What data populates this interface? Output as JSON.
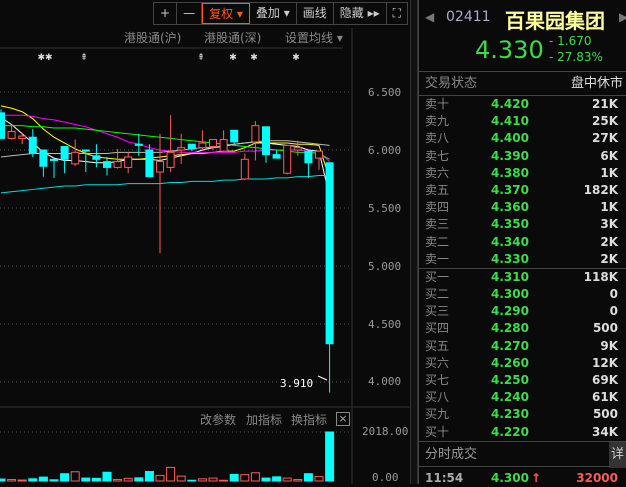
{
  "toolbar": {
    "plus": "+",
    "minus": "—",
    "fuquan": "复权 ▾",
    "overlay": "叠加 ▾",
    "draw": "画线",
    "hide": "隐藏 ▸▸",
    "fullscreen": "⛶"
  },
  "chart_tabs": {
    "hk_sh": "港股通(沪)",
    "hk_sz": "港股通(深)",
    "ma_setting": "设置均线 ▾"
  },
  "price_axis": [
    "6.500",
    "6.000",
    "5.500",
    "5.000",
    "4.500",
    "4.000"
  ],
  "low_marker": "3.910",
  "volume_tools": {
    "edit": "改参数",
    "add": "加指标",
    "switch": "换指标",
    "close": "×"
  },
  "volume_axis": [
    "2018.00",
    "0.00"
  ],
  "colors": {
    "up": "#ff5a5a",
    "down": "#00ffff",
    "green": "#3ddc4a",
    "accent": "#ff5a14"
  },
  "chart_data": {
    "type": "candlestick",
    "ylim": [
      3.85,
      6.6
    ],
    "ohlc": [
      [
        6.32,
        6.35,
        6.1,
        6.1
      ],
      [
        6.1,
        6.22,
        6.09,
        6.16
      ],
      [
        6.1,
        6.15,
        6.05,
        6.12
      ],
      [
        6.11,
        6.18,
        5.94,
        5.97
      ],
      [
        6.0,
        6.0,
        5.77,
        5.86
      ],
      [
        5.92,
        5.92,
        5.76,
        5.91
      ],
      [
        6.03,
        6.03,
        5.8,
        5.92
      ],
      [
        5.88,
        6.09,
        5.86,
        5.98
      ],
      [
        6.0,
        6.0,
        5.81,
        5.99
      ],
      [
        5.95,
        6.05,
        5.85,
        5.92
      ],
      [
        5.9,
        5.94,
        5.78,
        5.85
      ],
      [
        5.85,
        6.01,
        5.84,
        5.9
      ],
      [
        5.85,
        5.98,
        5.8,
        5.94
      ],
      [
        6.05,
        6.14,
        5.95,
        6.04
      ],
      [
        6.0,
        6.05,
        5.77,
        5.77
      ],
      [
        5.81,
        6.14,
        5.11,
        5.9
      ],
      [
        5.85,
        6.3,
        5.81,
        5.98
      ],
      [
        6.0,
        6.14,
        5.88,
        6.02
      ],
      [
        6.05,
        6.05,
        5.99,
        6.01
      ],
      [
        6.02,
        6.17,
        6.0,
        6.06
      ],
      [
        6.03,
        6.09,
        6.0,
        6.09
      ],
      [
        5.99,
        6.17,
        5.98,
        6.09
      ],
      [
        6.17,
        6.17,
        6.05,
        6.07
      ],
      [
        5.75,
        5.97,
        5.74,
        5.92
      ],
      [
        6.07,
        6.25,
        5.91,
        6.21
      ],
      [
        6.2,
        6.2,
        5.89,
        5.96
      ],
      [
        5.96,
        6.0,
        5.93,
        5.93
      ],
      [
        5.8,
        6.04,
        5.79,
        6.04
      ],
      [
        6.0,
        6.08,
        5.95,
        6.02
      ],
      [
        5.99,
        5.99,
        5.76,
        5.89
      ],
      [
        5.93,
        5.99,
        5.83,
        5.99
      ],
      [
        5.89,
        5.89,
        3.91,
        4.33
      ]
    ],
    "volume": [
      80,
      60,
      40,
      90,
      160,
      50,
      300,
      380,
      120,
      110,
      360,
      60,
      110,
      130,
      390,
      230,
      560,
      200,
      30,
      90,
      120,
      30,
      270,
      260,
      340,
      120,
      170,
      120,
      60,
      300,
      180,
      2018
    ],
    "ma": [
      {
        "color": "#ffffff",
        "values": [
          6.28,
          6.22,
          6.14,
          6.06,
          5.98,
          5.93,
          5.91,
          5.91,
          5.9,
          5.89,
          5.89,
          5.9,
          5.92,
          5.92,
          5.92,
          5.91,
          5.93,
          5.95,
          5.97,
          6.0,
          6.02,
          6.03,
          6.05,
          6.06,
          6.07,
          6.06,
          6.05,
          6.04,
          6.03,
          6.0,
          5.99,
          5.6
        ]
      },
      {
        "color": "#ffff00",
        "values": [
          6.38,
          6.36,
          6.33,
          6.27,
          6.18,
          6.11,
          6.06,
          6.01,
          5.97,
          5.94,
          5.93,
          5.92,
          5.92,
          5.92,
          5.93,
          5.94,
          5.95,
          5.96,
          5.97,
          5.97,
          5.98,
          5.99,
          5.99,
          6.02,
          6.06,
          6.06,
          6.06,
          6.06,
          6.05,
          6.05,
          6.04,
          5.75
        ]
      },
      {
        "color": "#ff00ff",
        "values": [
          6.3,
          6.3,
          6.3,
          6.29,
          6.27,
          6.26,
          6.24,
          6.22,
          6.2,
          6.17,
          6.14,
          6.11,
          6.07,
          6.05,
          6.02,
          6.0,
          5.99,
          5.98,
          5.98,
          5.98,
          5.98,
          5.98,
          5.98,
          5.99,
          5.99,
          6.0,
          6.0,
          6.0,
          6.0,
          5.99,
          5.98,
          5.9
        ]
      },
      {
        "color": "#00ff00",
        "values": [
          6.21,
          6.21,
          6.21,
          6.2,
          6.2,
          6.19,
          6.19,
          6.19,
          6.18,
          6.17,
          6.16,
          6.15,
          6.14,
          6.13,
          6.12,
          6.11,
          6.1,
          6.09,
          6.08,
          6.07,
          6.06,
          6.05,
          6.04,
          6.03,
          6.02,
          6.01,
          6.0,
          5.99,
          5.98,
          5.98,
          5.97,
          5.92
        ]
      },
      {
        "color": "#bbbbbb",
        "values": [
          5.94,
          5.95,
          5.96,
          5.97,
          5.97,
          5.97,
          5.97,
          5.97,
          5.97,
          5.97,
          5.97,
          5.98,
          5.98,
          5.98,
          5.98,
          5.98,
          5.99,
          6.0,
          6.01,
          6.02,
          6.02,
          6.04,
          6.05,
          6.06,
          6.07,
          6.08,
          6.08,
          6.08,
          6.07,
          6.06,
          6.05,
          6.04
        ]
      },
      {
        "color": "#00dddd",
        "values": [
          5.63,
          5.64,
          5.65,
          5.66,
          5.67,
          5.68,
          5.69,
          5.69,
          5.7,
          5.7,
          5.7,
          5.7,
          5.71,
          5.71,
          5.71,
          5.71,
          5.72,
          5.72,
          5.73,
          5.73,
          5.73,
          5.74,
          5.74,
          5.75,
          5.75,
          5.75,
          5.76,
          5.76,
          5.77,
          5.77,
          5.78,
          5.78
        ]
      }
    ],
    "markers": [
      "✱✱",
      "⇞",
      "⇞",
      "✱",
      "✱",
      "✱"
    ]
  },
  "quote": {
    "code": "02411",
    "name": "百果园集团",
    "last": "4.330",
    "change": "- 1.670",
    "change_pct": "- 27.83%",
    "status_label": "交易状态",
    "status_value": "盘中休市"
  },
  "asks": [
    {
      "label": "卖十",
      "price": "4.420",
      "vol": "21K"
    },
    {
      "label": "卖九",
      "price": "4.410",
      "vol": "25K"
    },
    {
      "label": "卖八",
      "price": "4.400",
      "vol": "27K"
    },
    {
      "label": "卖七",
      "price": "4.390",
      "vol": "6K"
    },
    {
      "label": "卖六",
      "price": "4.380",
      "vol": "1K"
    },
    {
      "label": "卖五",
      "price": "4.370",
      "vol": "182K"
    },
    {
      "label": "卖四",
      "price": "4.360",
      "vol": "1K"
    },
    {
      "label": "卖三",
      "price": "4.350",
      "vol": "3K"
    },
    {
      "label": "卖二",
      "price": "4.340",
      "vol": "2K"
    },
    {
      "label": "卖一",
      "price": "4.330",
      "vol": "2K"
    }
  ],
  "bids": [
    {
      "label": "买一",
      "price": "4.310",
      "vol": "118K"
    },
    {
      "label": "买二",
      "price": "4.300",
      "vol": "0"
    },
    {
      "label": "买三",
      "price": "4.290",
      "vol": "0"
    },
    {
      "label": "买四",
      "price": "4.280",
      "vol": "500"
    },
    {
      "label": "买五",
      "price": "4.270",
      "vol": "9K"
    },
    {
      "label": "买六",
      "price": "4.260",
      "vol": "12K"
    },
    {
      "label": "买七",
      "price": "4.250",
      "vol": "69K"
    },
    {
      "label": "买八",
      "price": "4.240",
      "vol": "61K"
    },
    {
      "label": "买九",
      "price": "4.230",
      "vol": "500"
    },
    {
      "label": "买十",
      "price": "4.220",
      "vol": "34K"
    }
  ],
  "ticks": {
    "title": "分时成交",
    "detail": "详",
    "time": "11:54",
    "price": "4.300",
    "arrow": "↑",
    "vol": "32000"
  }
}
